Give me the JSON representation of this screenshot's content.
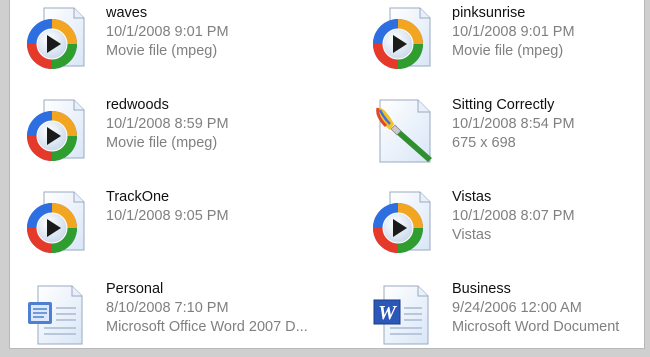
{
  "files": [
    {
      "name": "waves",
      "date": "10/1/2008 9:01 PM",
      "info": "Movie file (mpeg)",
      "icon": "media-player-icon"
    },
    {
      "name": "pinksunrise",
      "date": "10/1/2008 9:01 PM",
      "info": "Movie file (mpeg)",
      "icon": "media-player-icon"
    },
    {
      "name": "redwoods",
      "date": "10/1/2008 8:59 PM",
      "info": "Movie file (mpeg)",
      "icon": "media-player-icon"
    },
    {
      "name": "Sitting Correctly",
      "date": "10/1/2008 8:54 PM",
      "info": "675 x 698",
      "icon": "paint-brush-document-icon"
    },
    {
      "name": "TrackOne",
      "date": "10/1/2008 9:05 PM",
      "info": "",
      "icon": "media-player-icon"
    },
    {
      "name": "Vistas",
      "date": "10/1/2008 8:07 PM",
      "info": "Vistas",
      "icon": "media-player-icon"
    },
    {
      "name": "Personal",
      "date": "8/10/2008 7:10 PM",
      "info": "Microsoft Office Word 2007 D...",
      "icon": "word-2007-document-icon"
    },
    {
      "name": "Business",
      "date": "9/24/2006 12:00 AM",
      "info": "Microsoft Word Document",
      "icon": "word-document-icon"
    }
  ]
}
